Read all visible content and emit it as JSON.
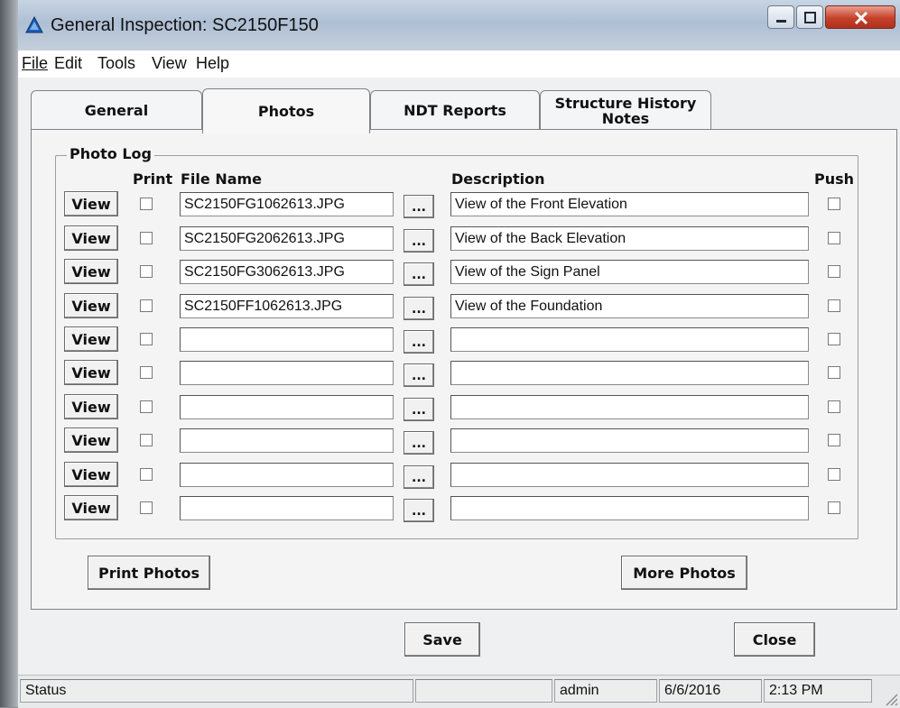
{
  "window": {
    "title": "General Inspection: SC2150F150"
  },
  "menu": [
    "File",
    "Edit",
    "Tools",
    "View",
    "Help"
  ],
  "tabs": [
    {
      "label": "General",
      "active": false
    },
    {
      "label": "Photos",
      "active": true
    },
    {
      "label": "NDT Reports",
      "active": false
    },
    {
      "label": "Structure History Notes",
      "active": false
    }
  ],
  "photo_log": {
    "group_label": "Photo Log",
    "headers": {
      "print": "Print",
      "file_name": "File Name",
      "description": "Description",
      "push": "Push"
    },
    "view_label": "View",
    "browse_label": "...",
    "rows": [
      {
        "file": "SC2150FG1062613.JPG",
        "description": "View of the Front Elevation",
        "print": false,
        "push": false
      },
      {
        "file": "SC2150FG2062613.JPG",
        "description": "View of the Back Elevation",
        "print": false,
        "push": false
      },
      {
        "file": "SC2150FG3062613.JPG",
        "description": "View of the Sign Panel",
        "print": false,
        "push": false
      },
      {
        "file": "SC2150FF1062613.JPG",
        "description": "View of the Foundation",
        "print": false,
        "push": false
      },
      {
        "file": "",
        "description": "",
        "print": false,
        "push": false
      },
      {
        "file": "",
        "description": "",
        "print": false,
        "push": false
      },
      {
        "file": "",
        "description": "",
        "print": false,
        "push": false
      },
      {
        "file": "",
        "description": "",
        "print": false,
        "push": false
      },
      {
        "file": "",
        "description": "",
        "print": false,
        "push": false
      },
      {
        "file": "",
        "description": "",
        "print": false,
        "push": false
      }
    ]
  },
  "buttons": {
    "print_photos": "Print Photos",
    "more_photos": "More Photos",
    "save": "Save",
    "close": "Close"
  },
  "statusbar": {
    "status": "Status",
    "user": "admin",
    "date": "6/6/2016",
    "time": "2:13 PM"
  }
}
